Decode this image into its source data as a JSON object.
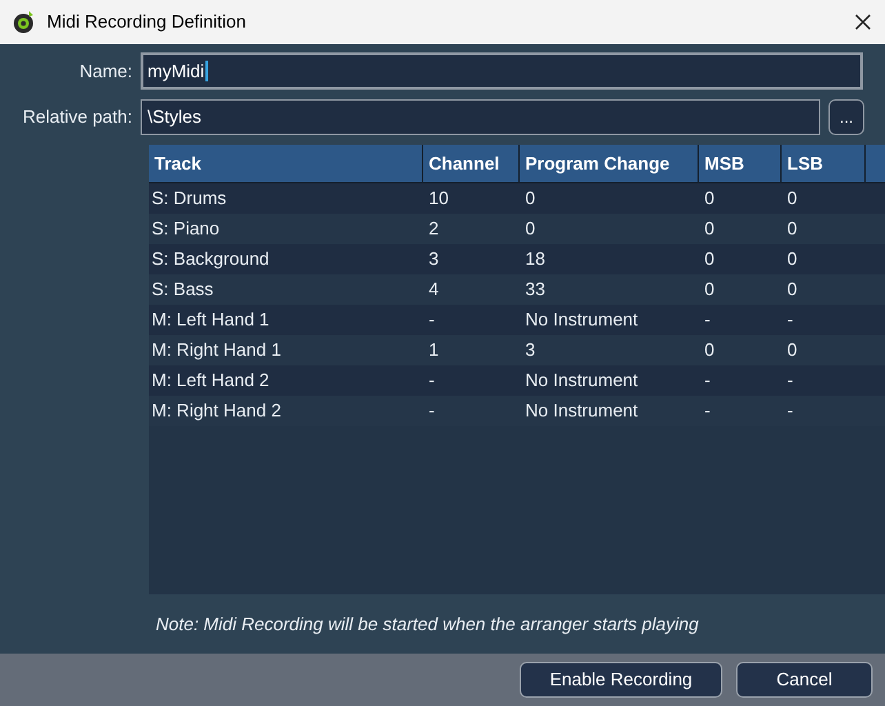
{
  "window": {
    "title": "Midi Recording Definition"
  },
  "form": {
    "name_label": "Name:",
    "name_value": "myMidi",
    "path_label": "Relative path:",
    "path_value": "\\Styles",
    "browse_button": "..."
  },
  "table": {
    "columns": [
      "Track",
      "Channel",
      "Program Change",
      "MSB",
      "LSB"
    ],
    "rows": [
      [
        "S: Drums",
        "10",
        "0",
        "0",
        "0"
      ],
      [
        "S: Piano",
        "2",
        "0",
        "0",
        "0"
      ],
      [
        "S: Background",
        "3",
        "18",
        "0",
        "0"
      ],
      [
        "S: Bass",
        "4",
        "33",
        "0",
        "0"
      ],
      [
        "M: Left Hand 1",
        "-",
        "No Instrument",
        "-",
        "-"
      ],
      [
        "M: Right Hand 1",
        "1",
        "3",
        "0",
        "0"
      ],
      [
        "M: Left Hand 2",
        "-",
        "No Instrument",
        "-",
        "-"
      ],
      [
        "M: Right Hand 2",
        "-",
        "No Instrument",
        "-",
        "-"
      ]
    ]
  },
  "note": "Note: Midi Recording will be started when the arranger starts playing",
  "buttons": [
    "Enable Recording",
    "Cancel"
  ]
}
